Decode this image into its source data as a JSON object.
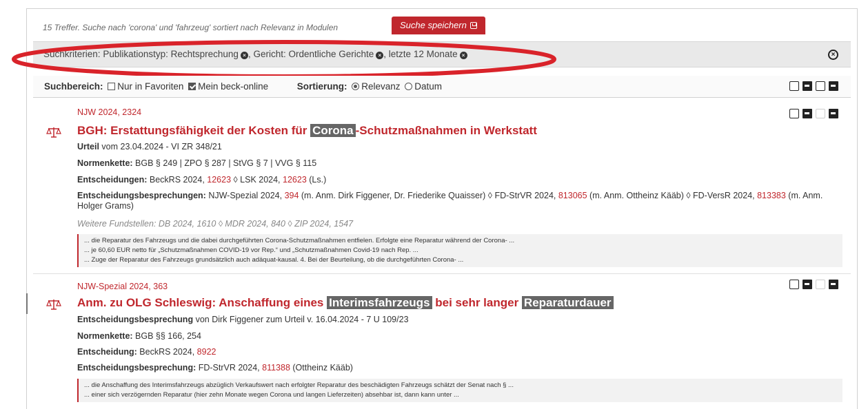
{
  "header": {
    "hits_text": "15 Treffer. Suche nach 'corona' und 'fahrzeug' sortiert nach Relevanz in Modulen",
    "save_search_label": "Suche speichern"
  },
  "criteria": {
    "prefix": "Suchkriterien:",
    "items": [
      "Publikationstyp: Rechtsprechung",
      "Gericht: Ordentliche Gerichte",
      "letzte 12 Monate"
    ]
  },
  "filterbar": {
    "scope_label": "Suchbereich:",
    "favorites_label": "Nur in Favoriten",
    "mine_label": "Mein beck-online",
    "sort_label": "Sortierung:",
    "sort_relevance": "Relevanz",
    "sort_date": "Datum"
  },
  "results": [
    {
      "citation": "NJW 2024, 2324",
      "title_pre": "BGH: Erstattungsfähigkeit der Kosten für ",
      "title_hl": "Corona",
      "title_post": "-Schutzmaßnahmen in Werkstatt",
      "meta_bold": "Urteil",
      "meta_rest": " vom 23.04.2024 - VI ZR 348/21",
      "norms_label": "Normenkette:",
      "norms": " BGB § 249 | ZPO § 287 | StVG § 7 | VVG § 115",
      "decisions_label": "Entscheidungen:",
      "decisions_a": " BeckRS 2024, ",
      "decisions_a_link": "12623",
      "decisions_b": " ◊ LSK 2024, ",
      "decisions_b_link": "12623",
      "decisions_c": " (Ls.)",
      "reviews_label": "Entscheidungsbesprechungen:",
      "reviews_1": " NJW-Spezial 2024, ",
      "reviews_1_link": "394",
      "reviews_2": " (m. Anm. Dirk Figgener, Dr. Friederike Quaisser) ◊ FD-StrVR 2024, ",
      "reviews_2_link": "813065",
      "reviews_3": " (m. Anm. Ottheinz Kääb) ◊ FD-VersR 2024, ",
      "reviews_3_link": "813383",
      "reviews_4": " (m. Anm. Holger Grams)",
      "further": "Weitere Fundstellen: DB 2024, 1610 ◊ MDR 2024, 840 ◊ ZIP 2024, 1547",
      "snippets": [
        "... die Reparatur des Fahrzeugs und die dabei durchgeführten Corona-Schutzmaßnahmen entfielen. Erfolgte eine Reparatur während der Corona- ...",
        "... je 60,60 EUR netto für „Schutzmaßnahmen COVID-19 vor Rep.“ und „Schutzmaßnahmen Covid-19 nach Rep. ...",
        "... Zuge der Reparatur des Fahrzeugs grundsätzlich auch adäquat-kausal. 4. Bei der Beurteilung, ob die durchgeführten Corona- ..."
      ]
    },
    {
      "citation": "NJW-Spezial 2024, 363",
      "title_a": "Anm. zu OLG Schleswig: Anschaffung eines ",
      "title_hl1": "Interimsfahrzeugs",
      "title_b": " bei sehr langer ",
      "title_hl2": "Reparaturdauer",
      "meta_bold": "Entscheidungsbesprechung",
      "meta_rest": " von Dirk Figgener zum Urteil v. 16.04.2024 - 7 U 109/23",
      "norms_label": "Normenkette:",
      "norms": " BGB §§ 166, 254",
      "decision_label": "Entscheidung:",
      "decision_a": " BeckRS 2024, ",
      "decision_a_link": "8922",
      "review_label": "Entscheidungsbesprechung:",
      "review_a": " FD-StrVR 2024, ",
      "review_a_link": "811388",
      "review_b": " (Ottheinz Kääb)",
      "snippets": [
        "... die Anschaffung des Interimsfahrzeugs abzüglich Verkaufswert nach erfolgter Reparatur des beschädigten Fahrzeugs schätzt der Senat nach § ...",
        "... einer sich verzögernden Reparatur (hier zehn Monate wegen Corona und langen Lieferzeiten) absehbar ist, dann kann unter ..."
      ]
    }
  ],
  "colors": {
    "accent": "#c0272d",
    "highlight": "#666666",
    "criteria_bg": "#e9e9e9"
  }
}
